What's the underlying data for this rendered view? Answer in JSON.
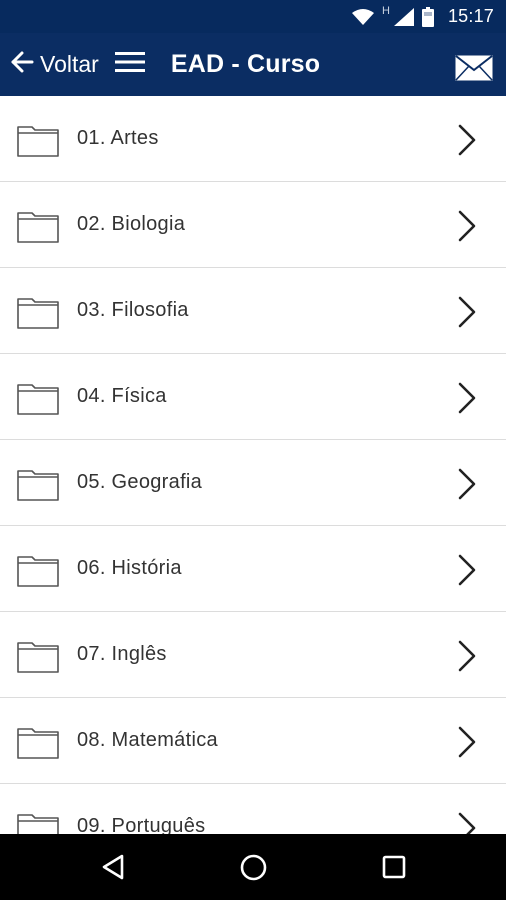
{
  "status_bar": {
    "time": "15:17",
    "network_letter": "H",
    "icons": [
      "wifi-icon",
      "cell-signal-icon",
      "battery-icon"
    ]
  },
  "app_bar": {
    "back_label": "Voltar",
    "title": "EAD - Curso",
    "icons": [
      "back-arrow-icon",
      "hamburger-menu-icon",
      "mail-icon"
    ]
  },
  "courses": [
    {
      "label": "01. Artes"
    },
    {
      "label": "02. Biologia"
    },
    {
      "label": "03. Filosofia"
    },
    {
      "label": "04. Física"
    },
    {
      "label": "05. Geografia"
    },
    {
      "label": "06. História"
    },
    {
      "label": "07. Inglês"
    },
    {
      "label": "08. Matemática"
    },
    {
      "label": "09. Português"
    }
  ],
  "colors": {
    "app_bar": "#0b2d63",
    "status_bar": "#072a5e",
    "text": "#333333",
    "divider": "#dcdcdc",
    "nav_bar": "#000000"
  },
  "nav_bar": {
    "icons": [
      "back-triangle-icon",
      "home-circle-icon",
      "recents-square-icon"
    ]
  }
}
